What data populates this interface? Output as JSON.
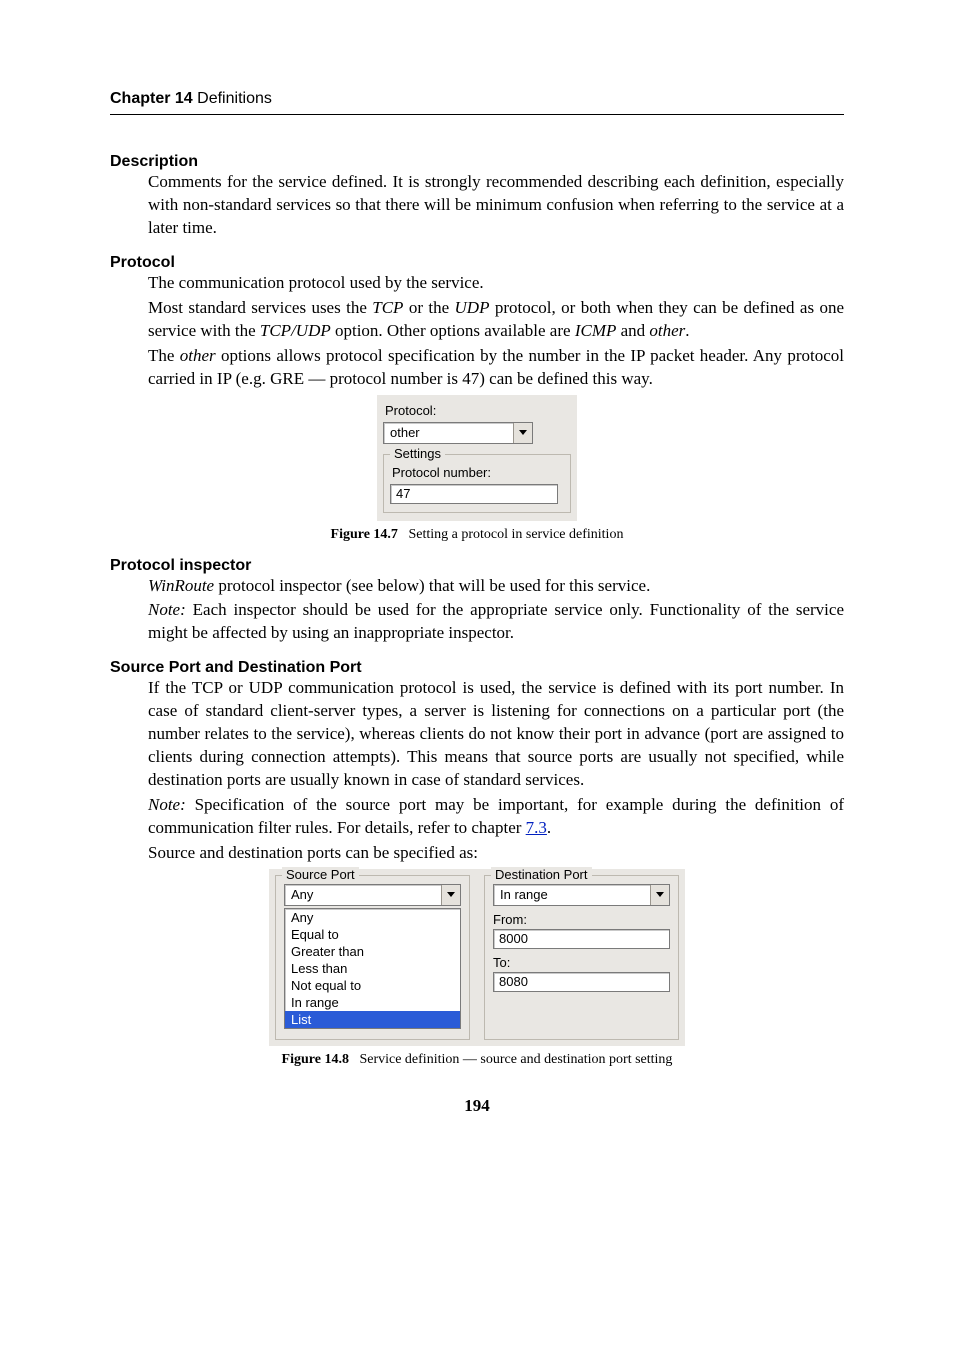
{
  "header": {
    "chapter": "Chapter 14",
    "title": "Definitions"
  },
  "desc": {
    "term": "Description",
    "p1": "Comments for the service defined. It is strongly recommended describing each definition, especially with non-standard services so that there will be minimum confusion when referring to the service at a later time."
  },
  "protocol": {
    "term": "Protocol",
    "p1": "The communication protocol used by the service.",
    "p2a": "Most standard services uses the ",
    "p2i1": "TCP",
    "p2b": " or the ",
    "p2i2": "UDP",
    "p2c": " protocol, or both when they can be defined as one service with the ",
    "p2i3": "TCP/UDP",
    "p2d": " option. Other options available are ",
    "p2i4": "ICMP",
    "p2e": " and ",
    "p2i5": "other",
    "p2f": ".",
    "p3a": "The ",
    "p3i1": "other",
    "p3b": " options allows protocol specification by the number in the IP packet header. Any protocol carried in IP (e.g. GRE — protocol number is 47) can be defined this way."
  },
  "fig7": {
    "lblProtocol": "Protocol:",
    "comboValue": "other",
    "legend": "Settings",
    "lblNumber": "Protocol number:",
    "value": "47",
    "captionBold": "Figure 14.7",
    "captionRest": "Setting a protocol in service definition"
  },
  "inspector": {
    "term": "Protocol inspector",
    "p1i": "WinRoute",
    "p1": " protocol inspector (see below) that will be used for this service.",
    "p2i": "Note:",
    "p2": " Each inspector should be used for the appropriate service only. Functionality of the service might be affected by using an inappropriate inspector."
  },
  "ports": {
    "term": "Source Port and Destination Port",
    "p1": "If the TCP or UDP communication protocol is used, the service is defined with its port number. In case of standard client-server types, a server is listening for connections on a particular port (the number relates to the service), whereas clients do not know their port in advance (port are assigned to clients during connection attempts). This means that source ports are usually not specified, while destination ports are usually known in case of standard services.",
    "p2i": "Note:",
    "p2a": " Specification of the source port may be important, for example during the definition of communication filter rules. For details, refer to chapter ",
    "p2link": "7.3",
    "p2b": ".",
    "p3": "Source and destination ports can be specified as:"
  },
  "fig8": {
    "srcLegend": "Source Port",
    "dstLegend": "Destination Port",
    "srcCombo": "Any",
    "srcOpts": [
      "Any",
      "Equal to",
      "Greater than",
      "Less than",
      "Not equal to",
      "In range",
      "List"
    ],
    "srcSelected": "List",
    "dstCombo": "In range",
    "lblFrom": "From:",
    "valFrom": "8000",
    "lblTo": "To:",
    "valTo": "8080",
    "captionBold": "Figure 14.8",
    "captionRest": "Service definition — source and destination port setting"
  },
  "pageNumber": "194"
}
